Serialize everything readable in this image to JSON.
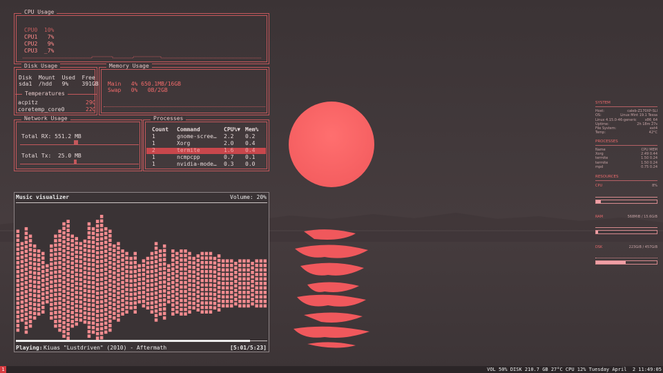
{
  "cpu": {
    "title": "CPU Usage",
    "rows": [
      "CPU0  10%",
      "CPU1   7%",
      "CPU2   9%",
      "CPU3  _7%"
    ]
  },
  "disk": {
    "title": "Disk Usage",
    "header": "Disk  Mount  Used  Free",
    "row": "sda1  /hdd   9%    391GB"
  },
  "memory": {
    "title": "Memory Usage",
    "main": "Main   4% 650.1MB/16GB",
    "swap": "Swap   0%   0B/2GB"
  },
  "temps": {
    "title": "Temperatures",
    "rows": [
      {
        "name": "acpitz",
        "value": "29C"
      },
      {
        "name": "coretemp_core0",
        "value": "22C"
      }
    ]
  },
  "network": {
    "title": "Network Usage",
    "rx": "Total RX: 551.2 MB",
    "tx": "Total Tx:  25.0 MB"
  },
  "processes": {
    "title": "Processes",
    "headers": [
      "Count",
      "Command",
      "CPU%▼",
      "Mem%"
    ],
    "rows": [
      [
        "1",
        "gnome-scree…",
        "2.2",
        "0.2"
      ],
      [
        "1",
        "Xorg",
        "2.0",
        "0.4"
      ],
      [
        "2",
        "termite",
        "1.6",
        "0.4"
      ],
      [
        "1",
        "ncmpcpp",
        "0.7",
        "0.1"
      ],
      [
        "1",
        "nvidia-mode…",
        "0.3",
        "0.0"
      ]
    ],
    "selected_index": 2
  },
  "music": {
    "title": "Music visualizer",
    "volume": "Volume: 20%",
    "playing_label": "Playing:",
    "track": "Kiuas \"Lustdriven\" (2010) - Aftermath",
    "time": "[5:01/5:23]",
    "progress": 0.93,
    "levels": [
      0.75,
      0.6,
      0.8,
      0.7,
      0.55,
      0.5,
      0.45,
      0.3,
      0.55,
      0.7,
      0.75,
      0.85,
      0.9,
      0.7,
      0.65,
      0.6,
      0.62,
      0.85,
      0.8,
      0.9,
      0.95,
      0.8,
      0.75,
      0.55,
      0.6,
      0.5,
      0.45,
      0.4,
      0.45,
      0.3,
      0.35,
      0.4,
      0.45,
      0.6,
      0.5,
      0.55,
      0.3,
      0.5,
      0.45,
      0.5,
      0.5,
      0.45,
      0.4,
      0.42,
      0.48,
      0.46,
      0.48,
      0.4,
      0.42,
      0.38,
      0.36,
      0.38,
      0.34,
      0.36,
      0.38,
      0.36,
      0.34,
      0.36,
      0.35,
      0.35
    ]
  },
  "conky": {
    "system_title": "SYSTEM",
    "system": [
      [
        "Host:",
        "caleb-Z170XP-SLI"
      ],
      [
        "OS:",
        "Linux Mint 19.1 Tessa"
      ],
      [
        "Linux 4.15.0-46-generic",
        "x86_64"
      ],
      [
        "Uptime:",
        "2h 18m 27s"
      ],
      [
        "File System:",
        "ext4"
      ],
      [
        "Temp:",
        "42°C"
      ]
    ],
    "proc_title": "PROCESSES",
    "proc_header": [
      "Name",
      "CPU MEM"
    ],
    "procs": [
      [
        "Xorg",
        "2.49   0.44"
      ],
      [
        "termite",
        "1.50   0.24"
      ],
      [
        "termite",
        "1.50   0.24"
      ],
      [
        "mpd",
        "0.75   0.24"
      ]
    ],
    "res_title": "RESOURCES",
    "cpu_label": "CPU",
    "cpu_value": "8%",
    "cpu_level": 0.08,
    "ram_label": "RAM",
    "ram_value": "568MiB / 15.6GiB",
    "ram_level": 0.036,
    "dsk_label": "DSK",
    "dsk_value": "223GiB / 457GiB",
    "dsk_level": 0.49
  },
  "statusbar": {
    "workspace": "1",
    "text": "VOL 50% DISK 210.7 GB 27°C CPU 12% Tuesday April  2 11:49:05"
  },
  "colors": {
    "accent": "#f06a6a",
    "border": "#c4585c",
    "sun": "#f55f61"
  }
}
